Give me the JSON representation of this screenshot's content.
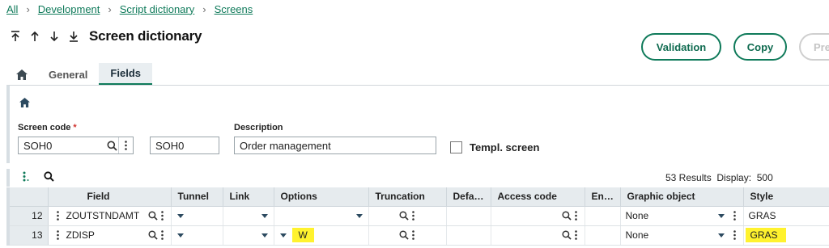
{
  "breadcrumb": [
    "All",
    "Development",
    "Script dictionary",
    "Screens"
  ],
  "title": "Screen dictionary",
  "actions": {
    "validation": "Validation",
    "copy": "Copy",
    "third": "Pre"
  },
  "tabs": [
    {
      "label": "General",
      "active": false
    },
    {
      "label": "Fields",
      "active": true
    }
  ],
  "form": {
    "screen_code_label": "Screen code",
    "screen_code_required_mark": "*",
    "screen_code_value": "SOH0",
    "second_code_value": "SOH0",
    "description_label": "Description",
    "description_value": "Order management",
    "templ_screen_label": "Templ. screen",
    "templ_screen_checked": false
  },
  "grid": {
    "results_text": "53 Results",
    "display_label": "Display:",
    "display_value": "500",
    "columns": [
      "Field",
      "Tunnel",
      "Link",
      "Options",
      "Truncation",
      "Defa…",
      "Access code",
      "En…",
      "Graphic object",
      "Style"
    ],
    "rows": [
      {
        "num": "12",
        "field": "ZOUTSTNDAMT",
        "options": "",
        "graphic_object": "None",
        "style": "GRAS",
        "style_highlight": false
      },
      {
        "num": "13",
        "field": "ZDISP",
        "options": "W",
        "graphic_object": "None",
        "style": "GRAS",
        "style_highlight": true
      }
    ]
  },
  "colors": {
    "accent": "#0f7a5a",
    "highlight": "#fff22e",
    "header_bg": "#e6ebee"
  }
}
